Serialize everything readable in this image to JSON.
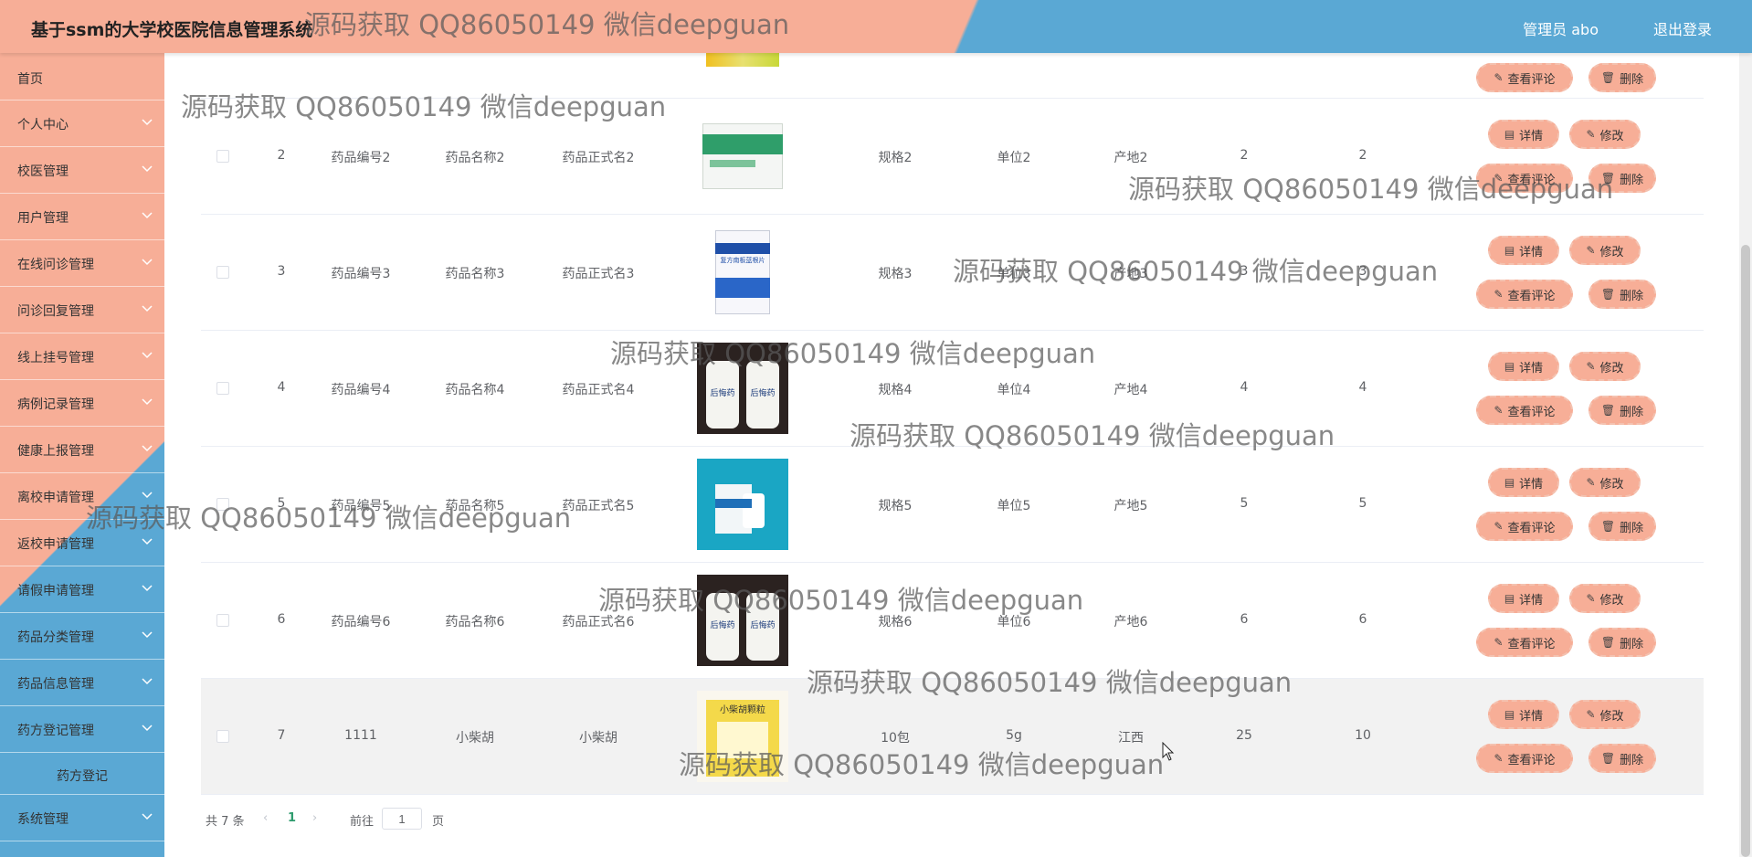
{
  "header": {
    "title": "基于ssm的大学校医院信息管理系统",
    "user": "管理员 abo",
    "logout": "退出登录"
  },
  "sidebar": {
    "items": [
      {
        "label": "首页"
      },
      {
        "label": "个人中心"
      },
      {
        "label": "校医管理"
      },
      {
        "label": "用户管理"
      },
      {
        "label": "在线问诊管理"
      },
      {
        "label": "问诊回复管理"
      },
      {
        "label": "线上挂号管理"
      },
      {
        "label": "病例记录管理"
      },
      {
        "label": "健康上报管理"
      },
      {
        "label": "离校申请管理"
      },
      {
        "label": "返校申请管理"
      },
      {
        "label": "请假申请管理"
      },
      {
        "label": "药品分类管理"
      },
      {
        "label": "药品信息管理"
      },
      {
        "label": "药方登记管理"
      },
      {
        "label": "药方登记"
      },
      {
        "label": "系统管理"
      }
    ]
  },
  "buttons": {
    "detail": "详情",
    "edit": "修改",
    "comments": "查看评论",
    "delete": "删除"
  },
  "rows": [
    {
      "idx": "2",
      "code": "药品编号2",
      "name": "药品名称2",
      "formal": "药品正式名2",
      "spec": "规格2",
      "unit": "单位2",
      "origin": "产地2",
      "c1": "2",
      "c2": "2",
      "img": "green-box"
    },
    {
      "idx": "3",
      "code": "药品编号3",
      "name": "药品名称3",
      "formal": "药品正式名3",
      "spec": "规格3",
      "unit": "单位3",
      "origin": "产地3",
      "c1": "3",
      "c2": "3",
      "img": "blue-box"
    },
    {
      "idx": "4",
      "code": "药品编号4",
      "name": "药品名称4",
      "formal": "药品正式名4",
      "spec": "规格4",
      "unit": "单位4",
      "origin": "产地4",
      "c1": "4",
      "c2": "4",
      "img": "bottles"
    },
    {
      "idx": "5",
      "code": "药品编号5",
      "name": "药品名称5",
      "formal": "药品正式名5",
      "spec": "规格5",
      "unit": "单位5",
      "origin": "产地5",
      "c1": "5",
      "c2": "5",
      "img": "teal-box"
    },
    {
      "idx": "6",
      "code": "药品编号6",
      "name": "药品名称6",
      "formal": "药品正式名6",
      "spec": "规格6",
      "unit": "单位6",
      "origin": "产地6",
      "c1": "6",
      "c2": "6",
      "img": "bottles"
    },
    {
      "idx": "7",
      "code": "1111",
      "name": "小柴胡",
      "formal": "小柴胡",
      "spec": "10包",
      "unit": "5g",
      "origin": "江西",
      "c1": "25",
      "c2": "10",
      "img": "yellow-box"
    }
  ],
  "pagination": {
    "total": "共 7 条",
    "current": "1",
    "goto": "前往",
    "goto_value": "1",
    "page_suffix": "页"
  },
  "watermark": "源码获取 QQ86050149 微信deepguan",
  "image_text": {
    "bottle_label": "后悔药",
    "yellow_box_label": "小柴胡颗粒",
    "blue_box_label": "复方南板蓝根片"
  }
}
